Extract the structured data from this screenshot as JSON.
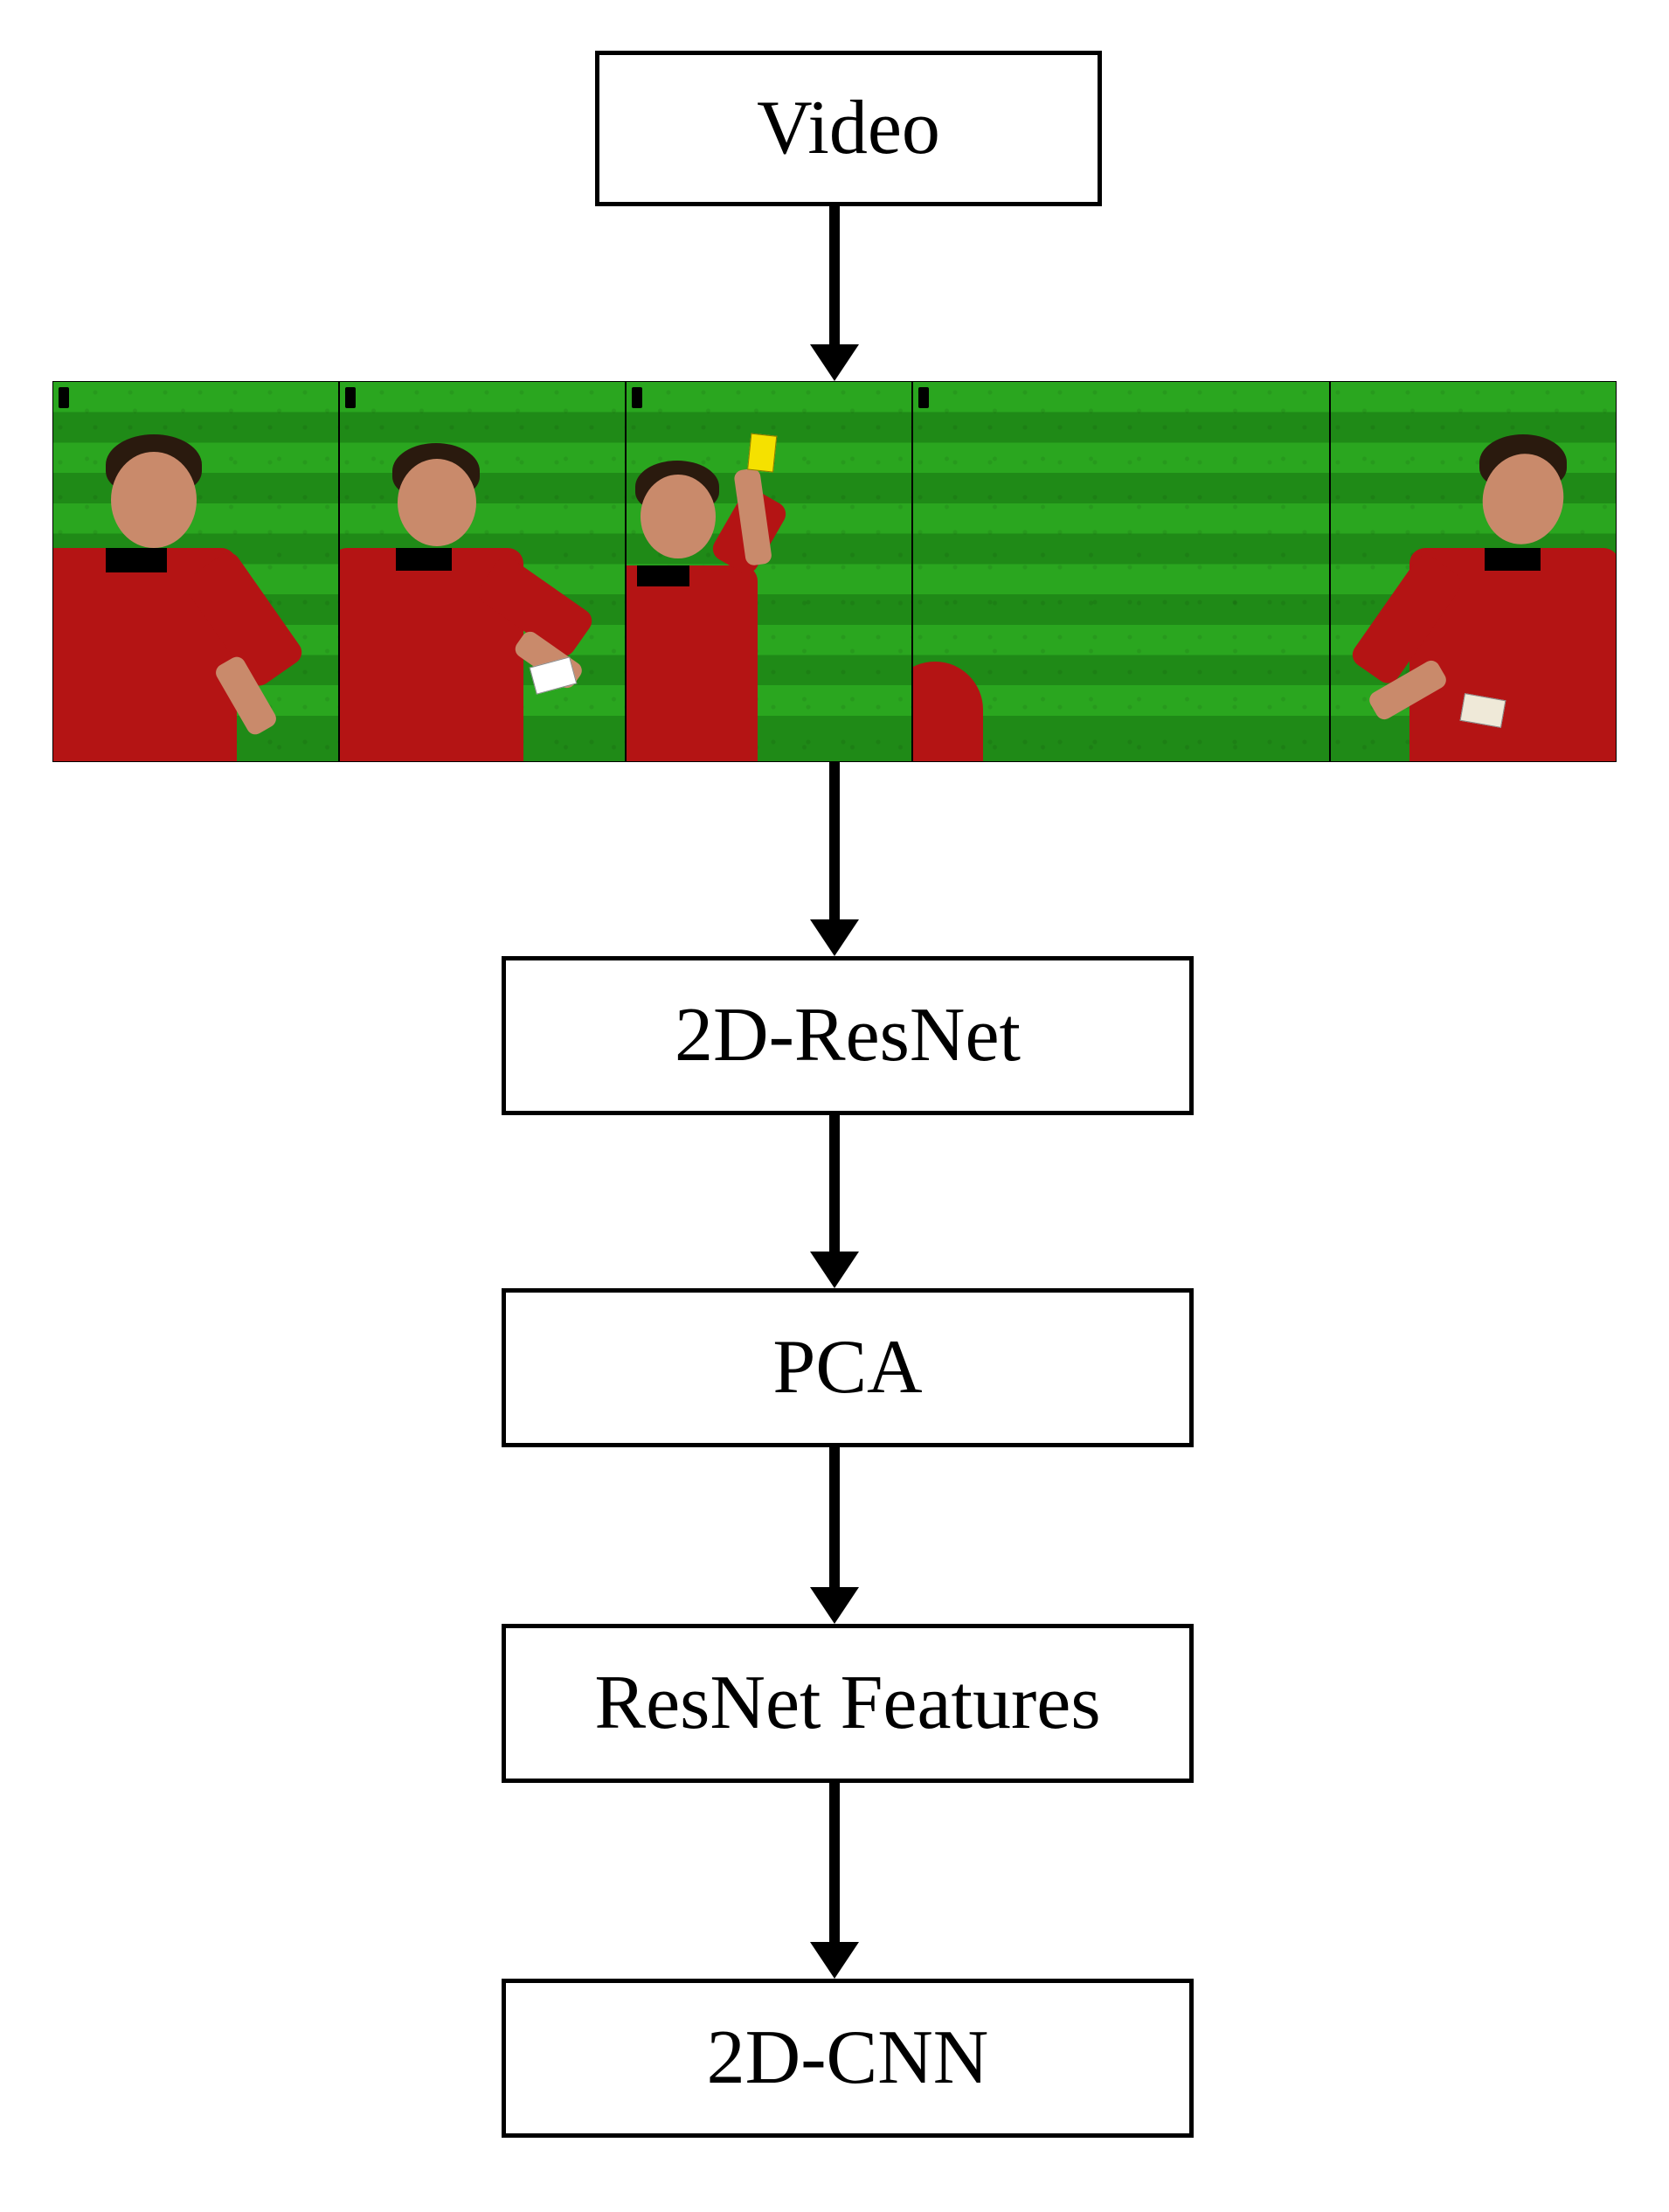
{
  "boxes": {
    "video": {
      "label": "Video"
    },
    "resnet2d": {
      "label": "2D-ResNet"
    },
    "pca": {
      "label": "PCA"
    },
    "features": {
      "label": "ResNet Features"
    },
    "cnn2d": {
      "label": "2D-CNN"
    }
  },
  "frames": {
    "count": 5,
    "overlay_text": "  "
  },
  "icons": {
    "arrow_down": "arrow-down-icon",
    "yellow_card": "yellow-card-icon",
    "referee": "referee-icon"
  }
}
